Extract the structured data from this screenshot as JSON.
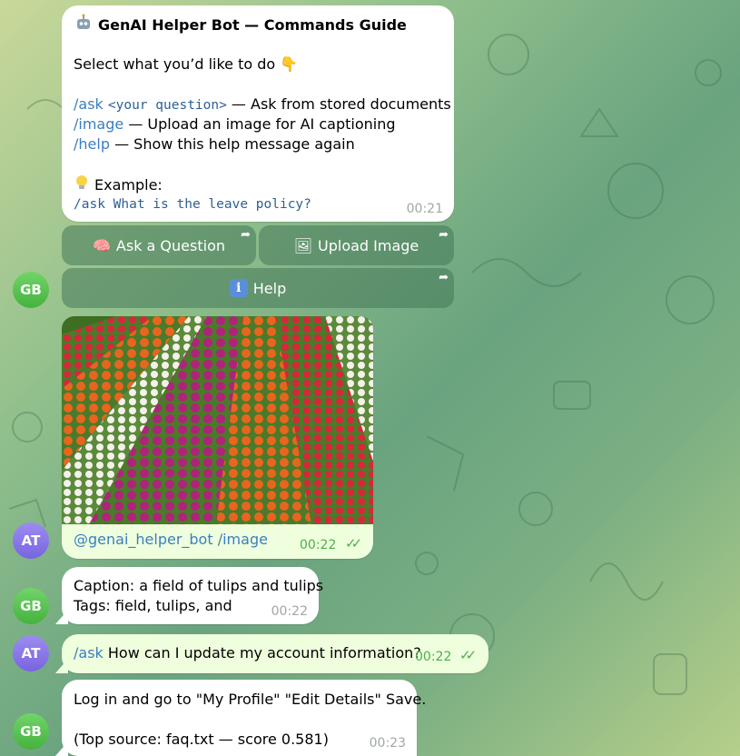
{
  "colors": {
    "accent": "#3a7fc1",
    "time_out": "#4fae4e",
    "bubble_in": "#ffffff",
    "bubble_out": "#effedd"
  },
  "guide": {
    "title": "GenAI Helper Bot — Commands Guide",
    "title_icon": "robot-icon",
    "prompt": "Select what you’d like to do 👇",
    "cmds": [
      {
        "cmd": "/ask",
        "arg": "<your question>",
        "desc": " — Ask from stored documents"
      },
      {
        "cmd": "/image",
        "desc": " — Upload an image for AI captioning"
      },
      {
        "cmd": "/help",
        "desc": " — Show this help message again"
      }
    ],
    "example_label": "Example:",
    "example_icon": "lightbulb-icon",
    "example_code": "/ask What is the leave policy?",
    "time": "00:21"
  },
  "buttons": {
    "ask": "Ask a Question",
    "upload": "Upload Image",
    "help": "Help"
  },
  "avatars": {
    "bot": "GB",
    "user": "AT"
  },
  "photo_msg": {
    "mention": "@genai_helper_bot",
    "cmd": " /image",
    "time": "00:22"
  },
  "caption_msg": {
    "caption": "Caption: a field of tulips and tulips",
    "tags": "Tags: field, tulips, and",
    "time": "00:22"
  },
  "ask_msg": {
    "cmd": "/ask",
    "text": " How can I update my account information?",
    "time": "00:22"
  },
  "answer_msg": {
    "line1": "Log in and go to \"My Profile\"  \"Edit Details\"  Save.",
    "line2": "(Top source: faq.txt — score 0.581)",
    "time": "00:23"
  }
}
